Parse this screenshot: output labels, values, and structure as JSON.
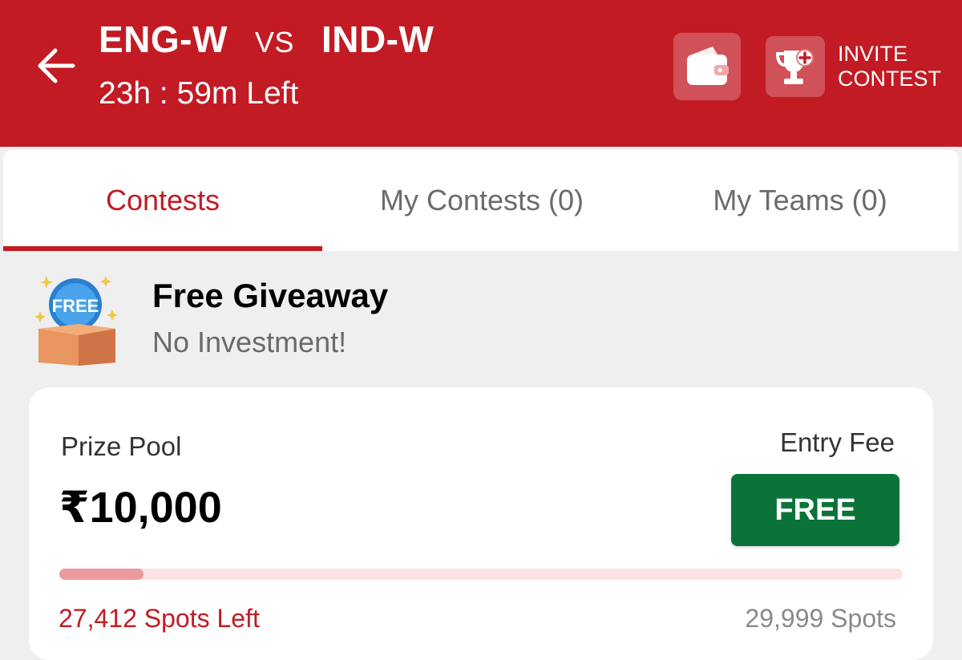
{
  "header": {
    "team1": "ENG-W",
    "vs": "VS",
    "team2": "IND-W",
    "time_left": "23h : 59m Left",
    "invite_label": "INVITE\nCONTEST",
    "icons": {
      "back": "back-arrow-icon",
      "wallet": "wallet-icon",
      "invite": "trophy-plus-icon"
    }
  },
  "tabs": [
    {
      "label": "Contests",
      "active": true
    },
    {
      "label": "My Contests (0)",
      "active": false
    },
    {
      "label": "My Teams (0)",
      "active": false
    }
  ],
  "giveaway": {
    "badge_text": "FREE",
    "title": "Free Giveaway",
    "subtitle": "No Investment!"
  },
  "contest": {
    "prize_label": "Prize Pool",
    "prize_value": "₹10,000",
    "entry_label": "Entry Fee",
    "fee_button": "FREE",
    "spots_left": "27,412 Spots Left",
    "spots_total": "29,999 Spots",
    "fill_fraction": 0.1
  },
  "colors": {
    "brand": "#c21b24",
    "button_green": "#0b7339",
    "background": "#efefef"
  }
}
